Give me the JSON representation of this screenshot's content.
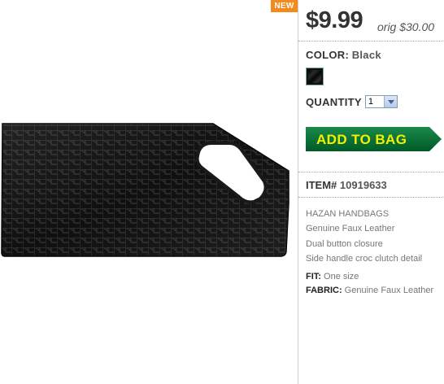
{
  "badge": {
    "label": "NEW"
  },
  "product": {
    "image_name": "black croc clutch handbag"
  },
  "price": {
    "current": "$9.99",
    "original": "orig $30.00"
  },
  "color": {
    "label": "COLOR:",
    "value": "Black",
    "swatch_color": "#111111"
  },
  "quantity": {
    "label": "QUANTITY",
    "value": "1"
  },
  "add_to_bag": {
    "label": "ADD TO BAG",
    "color": "#006633",
    "text_color": "#f2f200"
  },
  "item": {
    "label": "ITEM#",
    "number": "10919633"
  },
  "description": [
    "HAZAN HANDBAGS",
    "Genuine Faux Leather",
    "Dual button closure",
    "Side handle croc clutch detail"
  ],
  "details": {
    "fit_label": "FIT:",
    "fit_value": "One size",
    "fabric_label": "FABRIC:",
    "fabric_value": "Genuine Faux Leather"
  }
}
